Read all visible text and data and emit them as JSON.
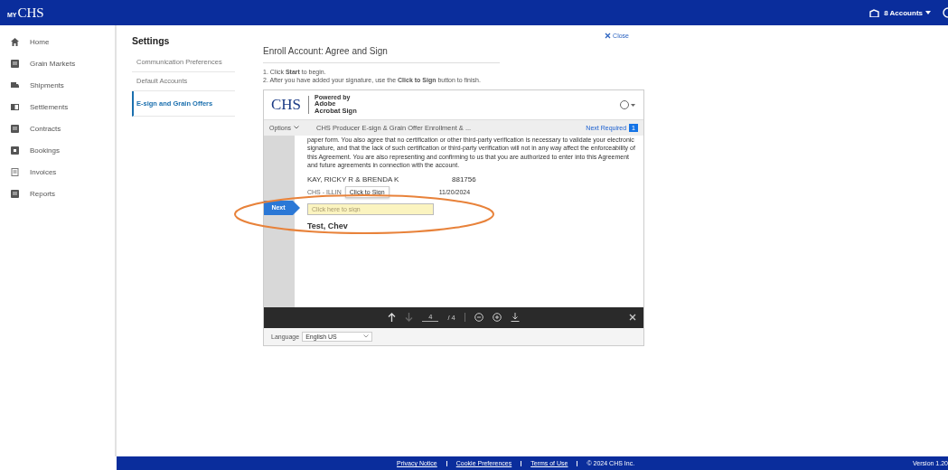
{
  "header": {
    "logo_prefix": "MY",
    "logo": "CHS",
    "accounts": "8 Accounts"
  },
  "nav": [
    {
      "label": "Home",
      "selected": false
    },
    {
      "label": "Grain Markets",
      "selected": false
    },
    {
      "label": "Shipments",
      "selected": false
    },
    {
      "label": "Settlements",
      "selected": false
    },
    {
      "label": "Contracts",
      "selected": false
    },
    {
      "label": "Bookings",
      "selected": false
    },
    {
      "label": "Invoices",
      "selected": false
    },
    {
      "label": "Reports",
      "selected": false
    }
  ],
  "settings": {
    "title": "Settings",
    "items": [
      {
        "label": "Communication Preferences",
        "selected": false
      },
      {
        "label": "Default Accounts",
        "selected": false
      },
      {
        "label": "E-sign and Grain Offers",
        "selected": true
      }
    ]
  },
  "close": "Close",
  "page_title": "Enroll Account: Agree and Sign",
  "instructions": [
    "1. Click **Start** to begin.",
    "2. After you have added your signature, use the **Click to Sign** button to finish."
  ],
  "signer": {
    "logo": "CHS",
    "powered_by": "Powered by",
    "brand_line_1": "Adobe",
    "brand_line_2": "Acrobat Sign",
    "options": "Options",
    "doc_title": "CHS Producer E-sign & Grain Offer Enrollment & ...",
    "next_required": "Next Required",
    "next_count": "1",
    "body": "paper form. You also agree that no certification or other third-party verification is necessary to validate your electronic signature, and that the lack of such certification or third-party verification will not in any way affect the enforceability of this Agreement. You are also representing and confirming to us that you are authorized to enter into this Agreement and future agreements in connection with the account.",
    "name": "KAY, RICKY R & BRENDA K",
    "account": "881756",
    "company": "CHS - ILLIN",
    "tooltip": "Click to Sign",
    "date": "11/20/2024",
    "next": "Next",
    "sign_placeholder": "Click here to sign",
    "signed_name": "Test, Chev",
    "page": "4",
    "page_total": "/ 4",
    "language_label": "Language",
    "language": "English US"
  },
  "footer": {
    "links": [
      "Privacy Notice",
      "Cookie Preferences",
      "Terms of Use"
    ],
    "copyright": "© 2024 CHS Inc.",
    "version": "Version 1.20"
  }
}
